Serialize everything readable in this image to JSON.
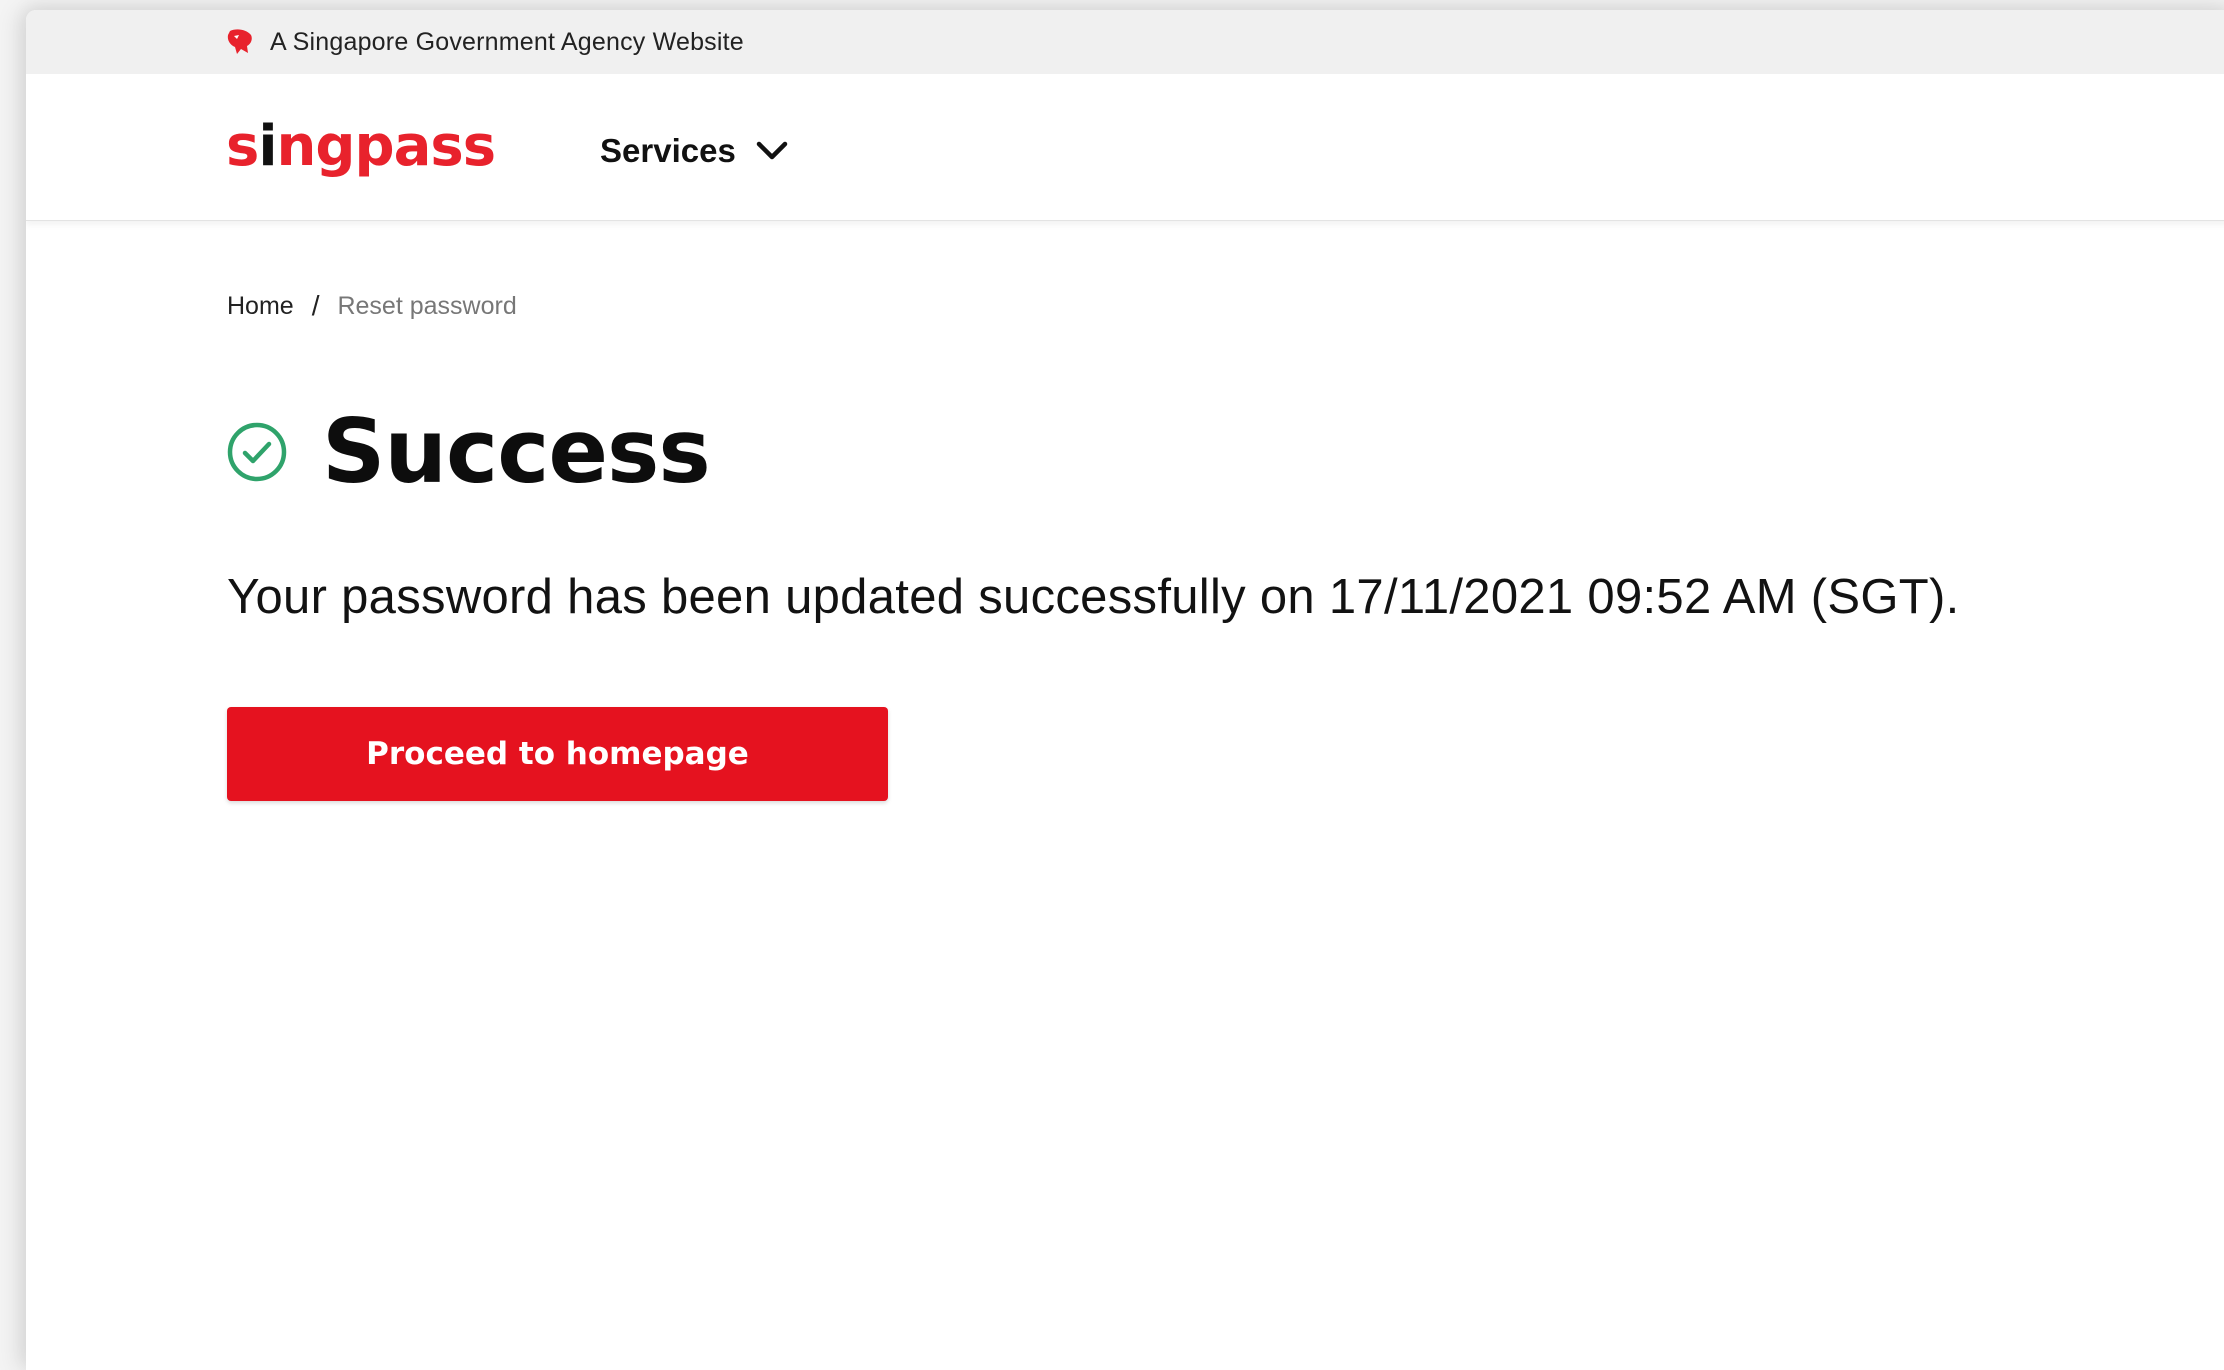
{
  "masthead": {
    "text": "A Singapore Government Agency Website",
    "icon": "lion-head-icon",
    "icon_color": "#e8222c"
  },
  "navbar": {
    "brand_pre": "s",
    "brand_i": "i",
    "brand_post": "ngpass",
    "brand_color": "#e8222c",
    "services_label": "Services"
  },
  "breadcrumb": {
    "home": "Home",
    "separator": "/",
    "current": "Reset password"
  },
  "main": {
    "title": "Success",
    "status_color": "#2fa36b",
    "message": "Your password has been updated successfully on 17/11/2021 09:52 AM (SGT).",
    "button_label": "Proceed to homepage",
    "button_color": "#e5121f"
  }
}
